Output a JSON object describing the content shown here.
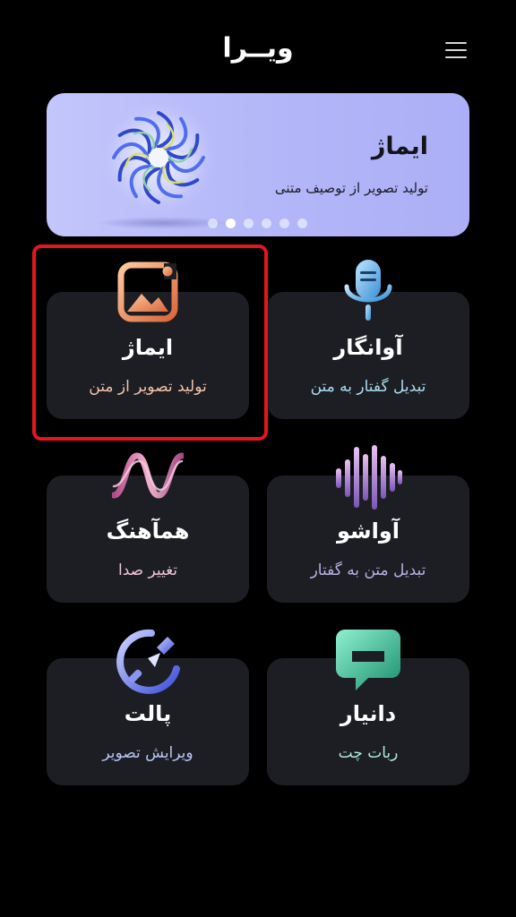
{
  "header": {
    "app_name": "ویــرا",
    "menu_icon": "hamburger-menu-icon"
  },
  "banner": {
    "title": "ایماژ",
    "subtitle": "تولید تصویر از توصیف متنی",
    "slide_count": 6,
    "active_slide": 2
  },
  "cards": [
    {
      "title": "آوانگار",
      "subtitle": "تبدیل گفتار به متن",
      "icon": "microphone-icon",
      "subtitle_color": "#a9dcf2"
    },
    {
      "title": "ایماژ",
      "subtitle": "تولید تصویر از متن",
      "icon": "image-gallery-icon",
      "subtitle_color": "#f4c2a8",
      "highlighted": true
    },
    {
      "title": "آواشو",
      "subtitle": "تبدیل متن به گفتار",
      "icon": "sound-wave-icon",
      "subtitle_color": "#b9b0e6"
    },
    {
      "title": "همآهنگ",
      "subtitle": "تغییر صدا",
      "icon": "wave-ribbon-icon",
      "subtitle_color": "#f0c6d8"
    },
    {
      "title": "دانیار",
      "subtitle": "ربات چت",
      "icon": "chat-bubble-icon",
      "subtitle_color": "#a8ecd8"
    },
    {
      "title": "پالت",
      "subtitle": "ویرایش تصویر",
      "icon": "paint-brush-icon",
      "subtitle_color": "#b8c3f5"
    }
  ],
  "colors": {
    "background": "#000000",
    "card": "#1d1e24",
    "highlight": "#e2161b",
    "banner": "#b3b6f8"
  }
}
